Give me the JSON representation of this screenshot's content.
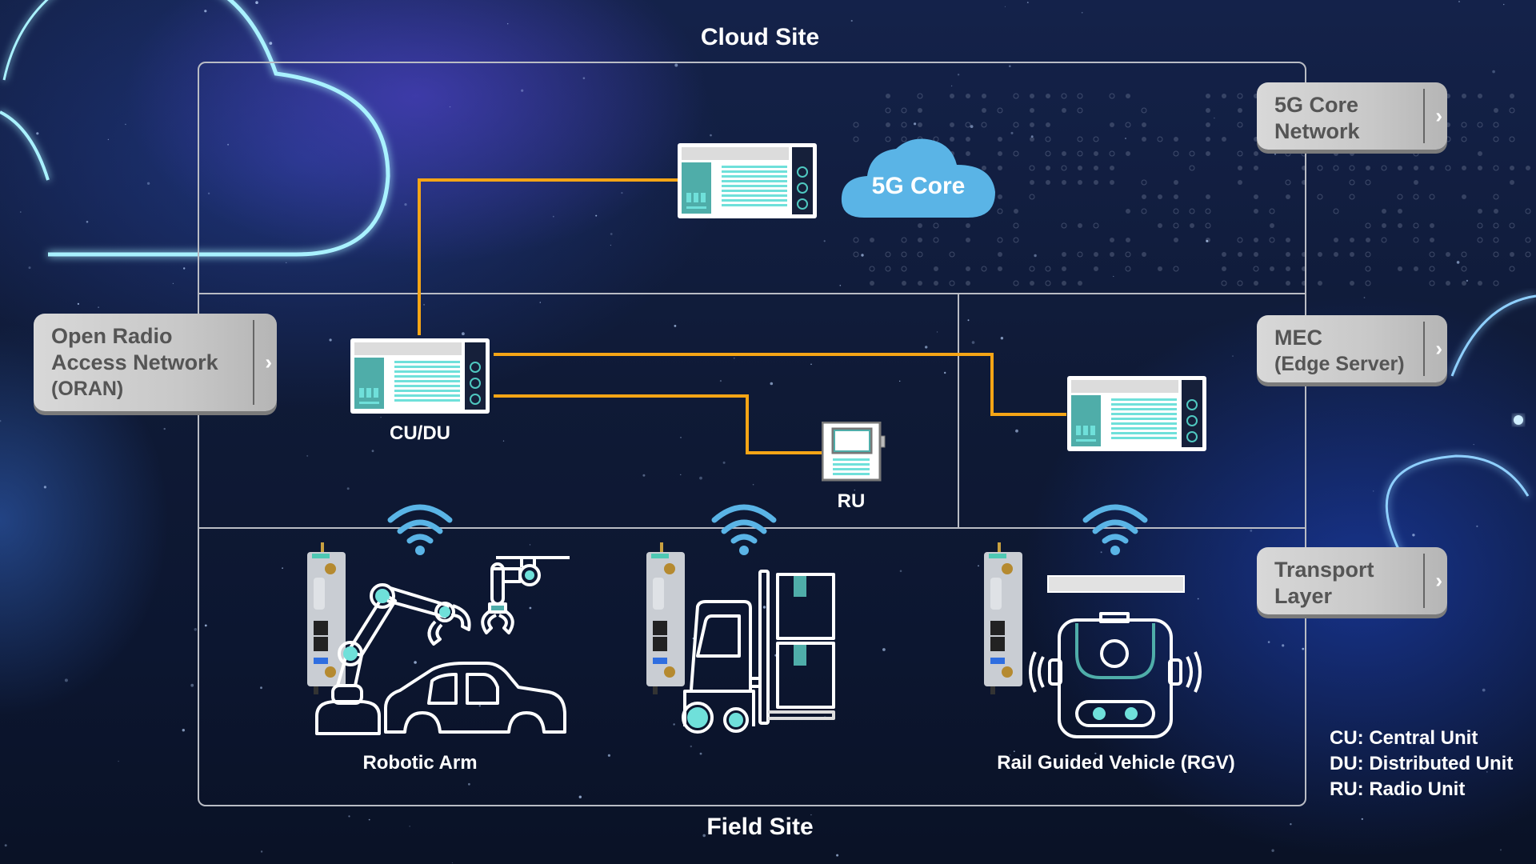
{
  "diagram": {
    "cloud_site_title": "Cloud Site",
    "field_site_title": "Field Site",
    "layer_labels": {
      "core_network": {
        "line1": "5G Core",
        "line2": "Network"
      },
      "mec": {
        "line1": "MEC",
        "line2": "(Edge Server)"
      },
      "transport": {
        "line1": "Transport",
        "line2": "Layer"
      },
      "oran": {
        "line1": "Open Radio",
        "line2": "Access Network",
        "line3": "(ORAN)"
      }
    },
    "nodes": {
      "core_cloud_label": "5G Core",
      "cudu_label": "CU/DU",
      "ru_label": "RU"
    },
    "field_devices": {
      "robotic_arm_label": "Robotic Arm",
      "forklift_label": "",
      "rgv_label": "Rail Guided Vehicle (RGV)"
    },
    "legend": [
      "CU: Central Unit",
      "DU: Distributed Unit",
      "RU: Radio Unit"
    ],
    "colors": {
      "link": "#f5a516",
      "wifi": "#5ab4e6",
      "accent_teal": "#4fada9",
      "cloud_fill": "#5ab4e6"
    }
  }
}
